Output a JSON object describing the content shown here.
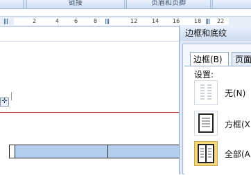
{
  "ribbon": {
    "groups": [
      "",
      "链接",
      "页眉和页脚",
      ""
    ]
  },
  "ruler": {
    "ticks": [
      "2",
      "4",
      "6",
      "8",
      "",
      "12",
      "14",
      "16",
      "18",
      "",
      "22"
    ]
  },
  "dialog": {
    "title": "边框和底纹",
    "tabs": [
      "边框(B)",
      "页面"
    ],
    "settings_label": "设置:",
    "presets": [
      {
        "label": "无(N)",
        "icon": "none-border-icon"
      },
      {
        "label": "方框(X",
        "icon": "box-border-icon"
      },
      {
        "label": "全部(A",
        "icon": "all-border-icon"
      }
    ]
  },
  "icons": {
    "move_handle": "table-move-handle-icon"
  },
  "colors": {
    "accent_blue": "#b3cdef",
    "selection_gold": "#f6d77a",
    "red_line": "#c0392b"
  }
}
